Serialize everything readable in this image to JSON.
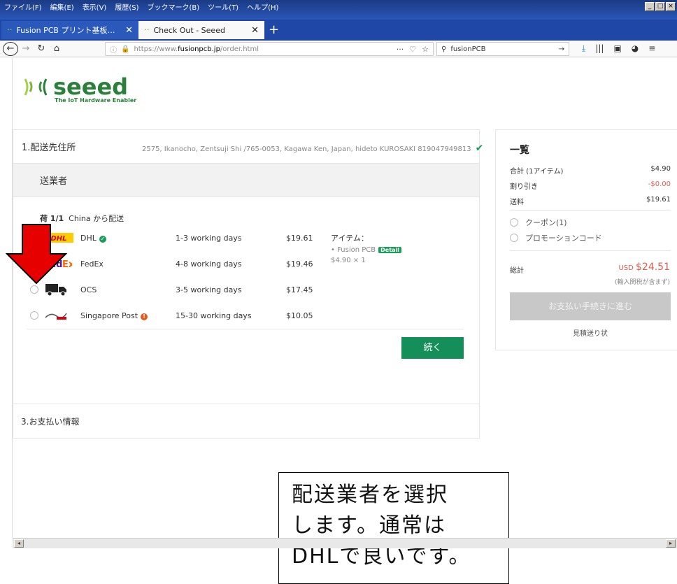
{
  "menu": [
    "ファイル(F)",
    "編集(E)",
    "表示(V)",
    "履歴(S)",
    "ブックマーク(B)",
    "ツール(T)",
    "ヘルプ(H)"
  ],
  "window_buttons": [
    "_",
    "□",
    "×"
  ],
  "tabs": [
    {
      "title": "Fusion PCB プリント基板の製造・"
    },
    {
      "title": "Check Out - Seeed"
    }
  ],
  "url": {
    "prefix": "https://www.",
    "domain": "fusionpcb.jp",
    "path": "/order.html"
  },
  "search": {
    "value": "fusionPCB"
  },
  "logo": {
    "name": "seeed",
    "tagline": "The IoT Hardware Enabler"
  },
  "steps": {
    "s1": {
      "label": "1.配送先住所",
      "address": "2575, Ikanocho, Zentsuji Shi /765-0053, Kagawa Ken, Japan, hideto KUROSAKI 819047949813"
    },
    "s2": {
      "label": "送業者"
    },
    "s3": {
      "label": "3.お支払い情報"
    }
  },
  "package": {
    "label": "荷 1/1",
    "origin": "China から配送"
  },
  "carriers": [
    {
      "name": "DHL",
      "days": "1-3 working days",
      "price": "$19.61",
      "selected": true
    },
    {
      "name": "FedEx",
      "days": "4-8 working days",
      "price": "$19.46",
      "selected": false
    },
    {
      "name": "OCS",
      "days": "3-5 working days",
      "price": "$17.45",
      "selected": false
    },
    {
      "name": "Singapore Post",
      "days": "15-30 working days",
      "price": "$10.05",
      "selected": false
    }
  ],
  "items": {
    "label": "アイテム：",
    "product": "Fusion PCB",
    "detail": "Detail",
    "price": "$4.90 × 1"
  },
  "continue_label": "続く",
  "summary": {
    "title": "一覧",
    "rows": [
      {
        "label": "合計 (1アイテム)",
        "value": "$4.90"
      },
      {
        "label": "割り引き",
        "value": "-$0.00"
      },
      {
        "label": "送料",
        "value": "$19.61"
      }
    ],
    "coupon": "クーポン(1)",
    "promo": "プロモーションコード",
    "total_label": "総計",
    "currency": "USD",
    "total": "$24.51",
    "tax_note": "(輸入関税が含まず)",
    "pay_button": "お支払い手続きに進む",
    "quote": "見積送り状"
  },
  "annotation": {
    "line1": "配送業者を選択",
    "line2": "します。通常は",
    "line3": "DHLで良いです。"
  },
  "colors": {
    "green": "#148f5a",
    "red_arrow": "#e60000",
    "firefox_blue": "#1f47a8"
  }
}
